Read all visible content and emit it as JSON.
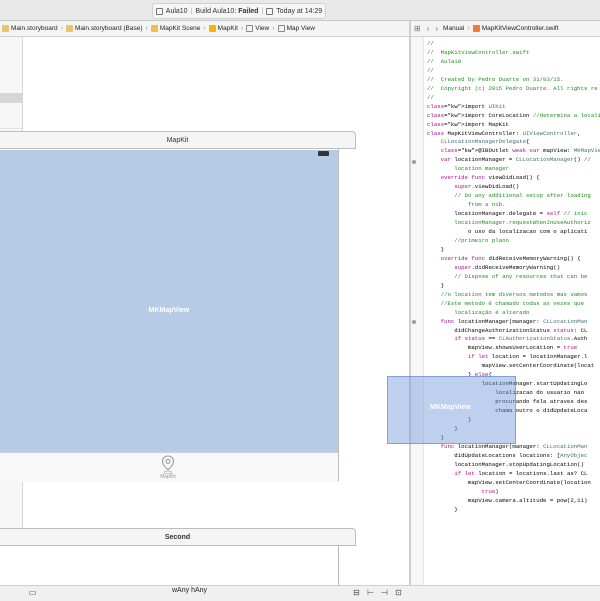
{
  "status": {
    "project": "Aula10",
    "build_prefix": "Build Aula10: ",
    "build_result": "Failed",
    "time": "Today at 14:29"
  },
  "jumpbar_left": {
    "crumbs": [
      "Main.storyboard",
      "Main.storyboard (Base)",
      "MapKit Scene",
      "MapKit",
      "View",
      "Map View"
    ]
  },
  "jumpbar_right": {
    "crumbs": [
      "Manual",
      "MapKitViewController.swift"
    ]
  },
  "scene1": {
    "title": "MapKit",
    "mapview_label": "MKMapView",
    "tab_label": "MapKit"
  },
  "scene2": {
    "title": "Second"
  },
  "bottom": {
    "size_class_w": "wAny",
    "size_class_h": "hAny"
  },
  "drag": {
    "label": "MKMapView"
  },
  "code_lines": [
    "//",
    "//  MapKitViewController.swift",
    "//  Aula10",
    "//",
    "//  Created by Pedro Duarte on 31/03/15.",
    "//  Copyright (c) 2015 Pedro Duarte. All rights re",
    "//",
    "",
    "import UIKit",
    "import CoreLocation //determina a localizacao do",
    "import MapKit",
    "",
    "class MapKitViewController: UIViewController,",
    "    CLLocationManagerDelegate{",
    "",
    "",
    "    @IBOutlet weak var mapView: MKMapView!",
    "",
    "",
    "    var locationManager = CLLocationManager() //",
    "        location manager",
    "",
    "",
    "",
    "",
    "    override func viewDidLoad() {",
    "        super.viewDidLoad()",
    "        // Do any additional setup after loading",
    "            from a nib.",
    "",
    "        locationManager.delegate = self // inic",
    "        locationManager.requestWhenInUseAuthoriz",
    "            o uso da localizacao com o aplicati",
    "        //primeiro plano",
    "",
    "",
    "",
    "    }",
    "",
    "    override func didReceiveMemoryWarning() {",
    "        super.didReceiveMemoryWarning()",
    "        // Dispose of any resources that can be",
    "    }",
    "",
    "    //o location tem diversos metodos mas vamos",
    "",
    "",
    "    //Este metodo é chamado todas as vezes que",
    "        localização é alterado",
    "    func locationManager(manager: CLLocationMan",
    "        didChangeAuthorizationStatus status: CL",
    "        if status == CLAuthorizationStatus.Auth",
    "            mapView.showsUserLocation = true",
    "",
    "            if let location = locationManager.l",
    "                mapView.setCenterCoordinate(locat",
    "",
    "            } else{",
    "                locationManager.startUpdatingLo",
    "                    localizacao do usuario nao",
    "                    procurando fela atraves des",
    "                    chama outro o didUpdateLoca",
    "            }",
    "        }",
    "    }",
    "",
    "    func locationManager(manager: CLLocationMan",
    "        didUpdateLocations locations: [AnyObjec",
    "        locationManager.stopUpdatingLocation()",
    "",
    "        if let location = locations.last as? CL",
    "            mapView.setCenterCoordinate(location",
    "                true)",
    "            mapView.camera.altitude = pow(2,11)",
    "        }"
  ],
  "colors": {
    "mapview": "#b6cbe6",
    "comment": "#1e8c1e",
    "keyword": "#aa0d91",
    "failed": "#000000"
  },
  "icons": {
    "status": "project-icon",
    "tab": "map-pin-icon"
  }
}
